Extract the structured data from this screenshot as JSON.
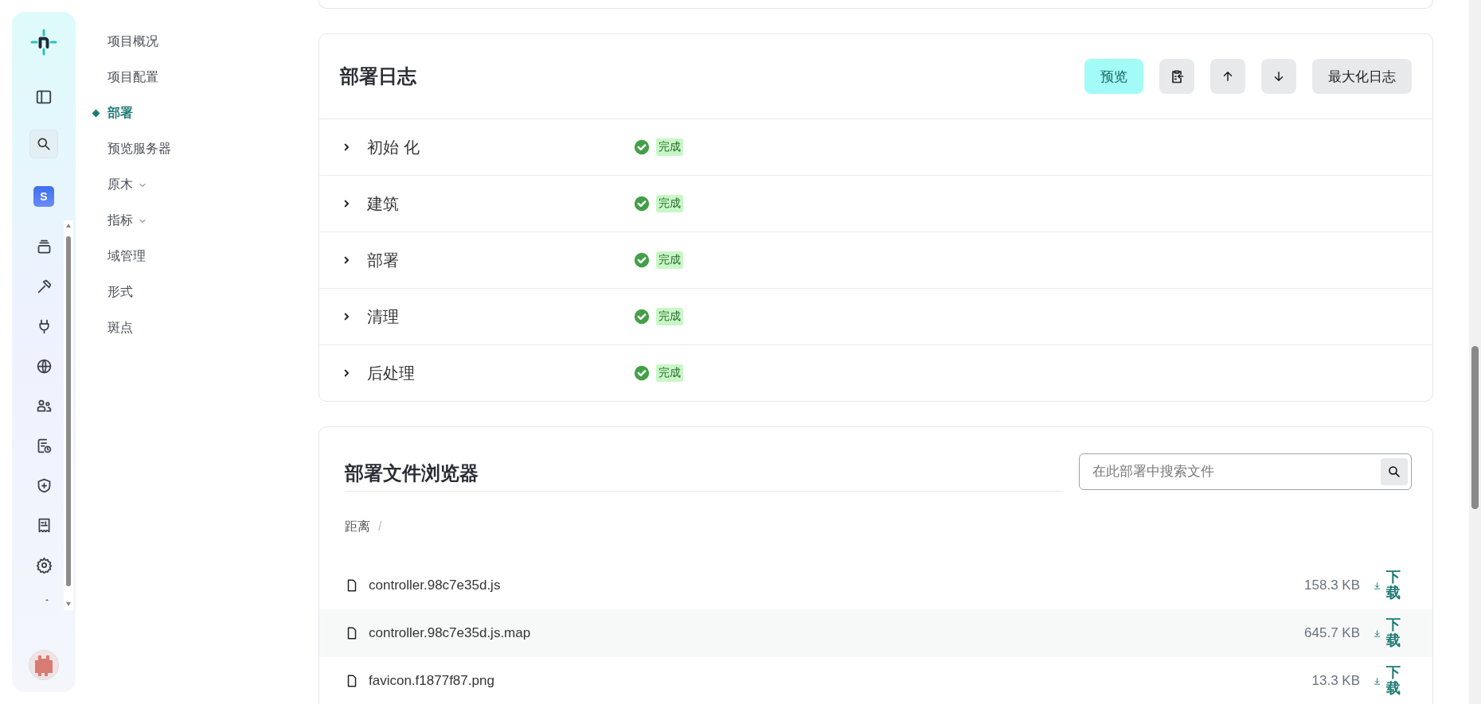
{
  "workspace": {
    "initial": "S"
  },
  "nav": [
    {
      "label": "项目概况",
      "selected": false,
      "kind": "link"
    },
    {
      "label": "项目配置",
      "selected": false,
      "kind": "link"
    },
    {
      "label": "部署",
      "selected": true,
      "kind": "link"
    },
    {
      "label": "预览服务器",
      "selected": false,
      "kind": "link"
    },
    {
      "label": "原木",
      "selected": false,
      "kind": "group"
    },
    {
      "label": "指标",
      "selected": false,
      "kind": "group"
    },
    {
      "label": "域管理",
      "selected": false,
      "kind": "link"
    },
    {
      "label": "形式",
      "selected": false,
      "kind": "link"
    },
    {
      "label": "斑点",
      "selected": false,
      "kind": "link"
    }
  ],
  "deploy_log": {
    "title": "部署日志",
    "buttons": [
      {
        "kind": "label",
        "label": "预览",
        "highlighted": true
      },
      {
        "kind": "clipboard"
      },
      {
        "kind": "up"
      },
      {
        "kind": "down"
      },
      {
        "kind": "label",
        "label": "最大化日志",
        "highlighted": false
      }
    ],
    "steps": [
      {
        "label": "初始 化",
        "expanded": false,
        "status": "完成"
      },
      {
        "label": "建筑",
        "expanded": false,
        "status": "完成"
      },
      {
        "label": "部署",
        "expanded": false,
        "status": "完成"
      },
      {
        "label": "清理",
        "expanded": false,
        "status": "完成"
      },
      {
        "label": "后处理",
        "expanded": false,
        "status": "完成"
      }
    ]
  },
  "file_browser": {
    "title": "部署文件浏览器",
    "search": {
      "placeholder": "在此部署中搜索文件"
    },
    "breadcrumb": [
      "距离"
    ],
    "separator": "/",
    "files": [
      {
        "name": "controller.98c7e35d.js",
        "size": "158.3 KB",
        "download": "下载"
      },
      {
        "name": "controller.98c7e35d.js.map",
        "size": "645.7 KB",
        "download": "下载"
      },
      {
        "name": "favicon.f1877f87.png",
        "size": "13.3 KB",
        "download": "下载"
      }
    ]
  }
}
